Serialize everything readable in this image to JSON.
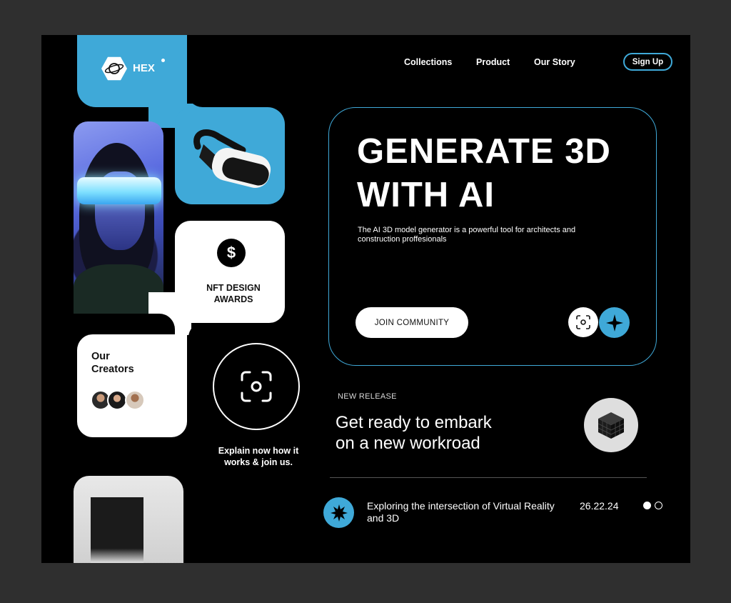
{
  "brand": {
    "name": "HEX"
  },
  "nav": {
    "items": [
      "Collections",
      "Product",
      "Our Story"
    ],
    "signup_label": "Sign Up"
  },
  "hero": {
    "title_line1": "GENERATE 3D",
    "title_line2": "WITH AI",
    "subtitle": "The AI 3D model generator is a powerful tool for architects and construction proffesionals",
    "cta_label": "JOIN COMMUNITY"
  },
  "nft": {
    "title": "NFT DESIGN AWARDS",
    "icon": "dollar-icon"
  },
  "creators": {
    "title_line1": "Our",
    "title_line2": "Creators"
  },
  "explain": {
    "text": "Explain now how it works & join us."
  },
  "release": {
    "label": "NEW RELEASE",
    "title_line1": "Get ready to embark",
    "title_line2": "on a new workroad"
  },
  "article": {
    "title": "Exploring the intersection of Virtual Reality and 3D",
    "date": "26.22.24"
  },
  "colors": {
    "accent": "#3fa9d8",
    "background": "#000000",
    "frame": "#2f2f2f"
  }
}
